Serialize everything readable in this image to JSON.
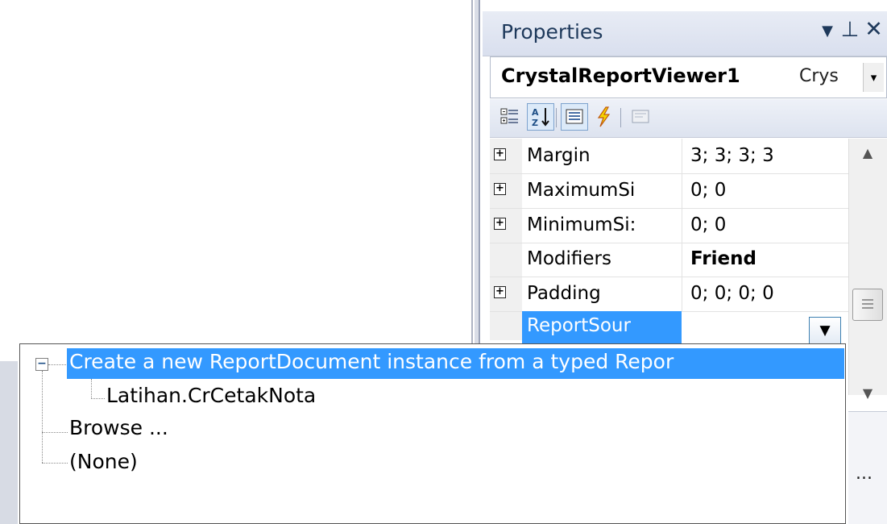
{
  "properties_panel": {
    "title": "Properties",
    "object_name": "CrystalReportViewer1",
    "object_type": "Crys",
    "toolbar_icons": [
      "categorized-icon",
      "alphabetical-icon",
      "properties-icon",
      "events-icon",
      "property-pages-icon"
    ]
  },
  "property_rows": [
    {
      "name": "Margin",
      "value": "3; 3; 3; 3",
      "expandable": true,
      "bold": false
    },
    {
      "name": "MaximumSi",
      "value": "0; 0",
      "expandable": true,
      "bold": false
    },
    {
      "name": "MinimumSi:",
      "value": "0; 0",
      "expandable": true,
      "bold": false
    },
    {
      "name": "Modifiers",
      "value": "Friend",
      "expandable": false,
      "bold": true
    },
    {
      "name": "Padding",
      "value": "0; 0; 0; 0",
      "expandable": true,
      "bold": false
    }
  ],
  "selected_property": {
    "name": "ReportSour",
    "value": ""
  },
  "dropdown_tree": {
    "root": "Create a new ReportDocument instance from a typed Repor",
    "child": "Latihan.CrCetakNota",
    "browse": "Browse ...",
    "none": "(None)"
  },
  "description_ellipsis": "...",
  "colors": {
    "selection": "#3399ff",
    "title_text": "#1e395b"
  }
}
